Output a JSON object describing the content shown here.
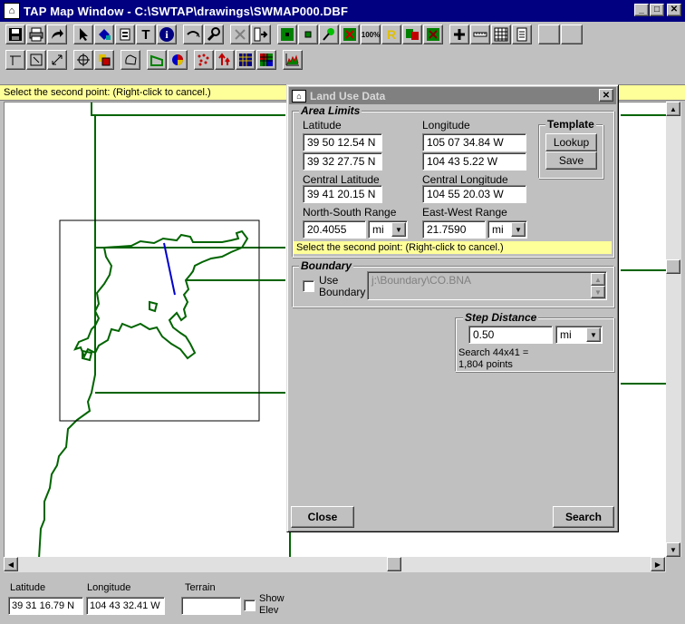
{
  "window": {
    "title": "TAP Map Window - C:\\SWTAP\\drawings\\SWMAP000.DBF",
    "minimize": "_",
    "maximize": "□",
    "close": "✕"
  },
  "toolbar1": {
    "items": [
      "save-icon",
      "print-icon",
      "redo-icon",
      "|",
      "pointer-icon",
      "fill-icon",
      "properties-icon",
      "text-icon",
      "info-icon",
      "|",
      "pan-icon",
      "tools-icon",
      "|",
      "cut-icon",
      "export-icon",
      "|",
      "site-icon",
      "small-site-icon",
      "pin-icon",
      "delete-icon",
      "zoom-100-icon",
      "r-icon",
      "swap-icon",
      "grid-icon",
      "|",
      "plus-icon",
      "ruler-icon",
      "table-icon",
      "notes-icon",
      "|",
      "blank-1",
      "blank-2"
    ],
    "zoom_label": "100%",
    "r_label": "R",
    "text_label": "T",
    "info_label": "i"
  },
  "toolbar2": {
    "items": [
      "line-icon",
      "node-icon",
      "resize-icon",
      "|",
      "crosshair-icon",
      "layers-icon",
      "|",
      "polygon-icon",
      "|",
      "area-icon",
      "pie-icon",
      "|",
      "scatter-icon",
      "arrow-icon",
      "grid-a-icon",
      "grid-b-icon",
      "|",
      "profile-icon"
    ]
  },
  "status_hint": "Select the second point: (Right-click to cancel.)",
  "dialog": {
    "title": "Land Use Data",
    "close": "✕",
    "area_limits": {
      "title": "Area Limits",
      "latitude_label": "Latitude",
      "longitude_label": "Longitude",
      "lat1": "39 50 12.54 N",
      "lat2": "39 32 27.75 N",
      "lon1": "105 07 34.84 W",
      "lon2": "104 43 5.22 W",
      "central_lat_label": "Central Latitude",
      "central_lon_label": "Central Longitude",
      "central_lat": "39 41 20.15 N",
      "central_lon": "104 55 20.03 W",
      "ns_range_label": "North-South Range",
      "ew_range_label": "East-West Range",
      "ns_range": "20.4055",
      "ew_range": "21.7590",
      "ns_unit": "mi",
      "ew_unit": "mi",
      "hint": "Select the second point: (Right-click to cancel.)"
    },
    "template": {
      "title": "Template",
      "lookup": "Lookup",
      "save": "Save"
    },
    "boundary": {
      "title": "Boundary",
      "use_boundary_line1": "Use",
      "use_boundary_line2": "Boundary",
      "path": "j:\\Boundary\\CO.BNA"
    },
    "step": {
      "title": "Step Distance",
      "value": "0.50",
      "unit": "mi",
      "summary_line1": "Search 44x41 =",
      "summary_line2": "1,804 points"
    },
    "close_button": "Close",
    "search_button": "Search"
  },
  "bottom": {
    "latitude_label": "Latitude",
    "longitude_label": "Longitude",
    "terrain_label": "Terrain",
    "latitude": "39 31 16.79 N",
    "longitude": "104 43 32.41 W",
    "terrain": "",
    "show_elev_line1": "Show",
    "show_elev_line2": "Elev"
  },
  "colors": {
    "map_line": "#006400",
    "selection_line": "#0000cc",
    "title_bar": "#000080",
    "hint_bg": "#ffff99"
  }
}
